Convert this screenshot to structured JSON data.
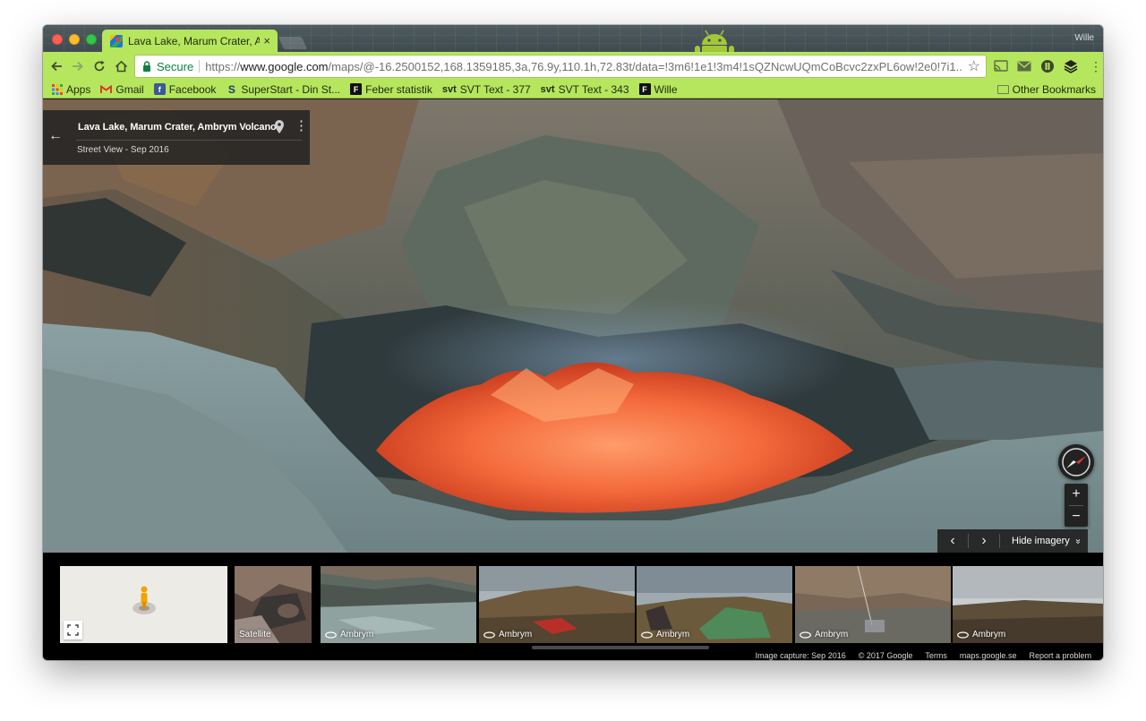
{
  "browser": {
    "tab_title": "Lava Lake, Marum Crater, Amb",
    "tab_close": "×",
    "profile_name": "Wille",
    "secure_label": "Secure",
    "url_scheme": "https://",
    "url_host": "www.google.com",
    "url_path": "/maps/@-16.2500152,168.1359185,3a,76.9y,110.1h,72.83t/data=!3m6!1e1!3m4!1sQZNcwUQmCoBcvc2zxPL6ow!2e0!7i1...",
    "theme_color": "#b6e65d",
    "secure_color": "#0b8043",
    "icons": [
      "back-arrow-icon",
      "forward-arrow-icon",
      "reload-icon",
      "home-icon",
      "lock-icon",
      "star-icon",
      "cast-icon",
      "mail-icon",
      "extension-icon",
      "layers-icon",
      "menu-dots-icon",
      "android-icon"
    ]
  },
  "bookmarks": {
    "items": [
      {
        "label": "Apps",
        "icon": "apps-grid-icon"
      },
      {
        "label": "Gmail",
        "icon": "gmail-icon"
      },
      {
        "label": "Facebook",
        "icon": "facebook-icon"
      },
      {
        "label": "SuperStart - Din St...",
        "icon": "s-icon"
      },
      {
        "label": "Feber statistik",
        "icon": "f-icon"
      },
      {
        "label": "SVT Text - 377",
        "prefix": "svt"
      },
      {
        "label": "SVT Text - 343",
        "prefix": "svt"
      },
      {
        "label": "Wille",
        "icon": "f-icon"
      }
    ],
    "f_letter": "F",
    "s_letter": "S",
    "other": "Other Bookmarks"
  },
  "streetview": {
    "place_name": "Lava Lake, Marum Crater, Ambrym Volcano",
    "subtitle": "Street View - Sep 2016",
    "back_arrow": "←",
    "more": "⋮",
    "zoom_in": "+",
    "zoom_out": "−",
    "prev": "‹",
    "next": "›",
    "hide_imagery": "Hide imagery",
    "hide_chevron": "»",
    "lava_color": "#f25a2a"
  },
  "filmstrip": {
    "satellite_label": "Satellite",
    "thumbnails": [
      {
        "label": "Ambrym",
        "active": true
      },
      {
        "label": "Ambrym",
        "active": false
      },
      {
        "label": "Ambrym",
        "active": false
      },
      {
        "label": "Ambrym",
        "active": false
      },
      {
        "label": "Ambrym",
        "active": false
      }
    ]
  },
  "footer": {
    "image_capture": "Image capture: Sep 2016",
    "copyright": "© 2017 Google",
    "terms": "Terms",
    "domain": "maps.google.se",
    "report": "Report a problem"
  }
}
